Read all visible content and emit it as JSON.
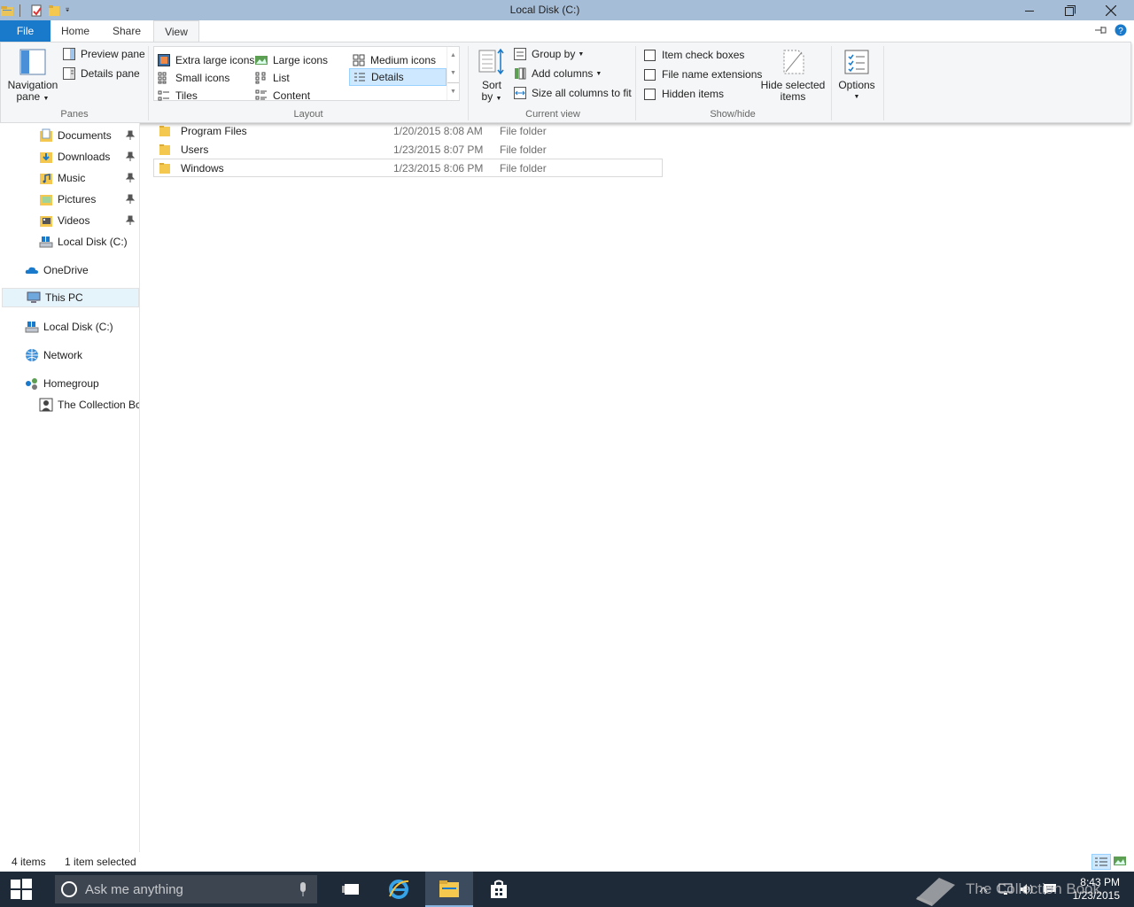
{
  "window": {
    "title": "Local Disk (C:)"
  },
  "ribbon": {
    "tabs": [
      {
        "label": "File"
      },
      {
        "label": "Home"
      },
      {
        "label": "Share"
      },
      {
        "label": "View"
      }
    ],
    "panes": {
      "navigation_pane_line1": "Navigation",
      "navigation_pane_line2": "pane",
      "preview_pane": "Preview pane",
      "details_pane": "Details pane",
      "group_label": "Panes"
    },
    "layout": {
      "items": [
        "Extra large icons",
        "Large icons",
        "Medium icons",
        "Small icons",
        "List",
        "Details",
        "Tiles",
        "Content"
      ],
      "selected": "Details",
      "group_label": "Layout"
    },
    "current_view": {
      "sort_line1": "Sort",
      "sort_line2": "by",
      "group_by": "Group by",
      "add_columns": "Add columns",
      "size_all_columns": "Size all columns to fit",
      "group_label": "Current view"
    },
    "show_hide": {
      "item_check_boxes": "Item check boxes",
      "file_name_extensions": "File name extensions",
      "hidden_items": "Hidden items",
      "hide_selected_line1": "Hide selected",
      "hide_selected_line2": "items",
      "group_label": "Show/hide"
    },
    "options": {
      "label": "Options"
    }
  },
  "navigation": {
    "items": [
      {
        "label": "Documents",
        "icon": "documents-icon",
        "pinned": true
      },
      {
        "label": "Downloads",
        "icon": "downloads-icon",
        "pinned": true
      },
      {
        "label": "Music",
        "icon": "music-icon",
        "pinned": true
      },
      {
        "label": "Pictures",
        "icon": "pictures-icon",
        "pinned": true
      },
      {
        "label": "Videos",
        "icon": "videos-icon",
        "pinned": true
      },
      {
        "label": "Local Disk (C:)",
        "icon": "drive-icon",
        "pinned": false
      },
      {
        "label": "OneDrive",
        "icon": "onedrive-icon"
      },
      {
        "label": "This PC",
        "icon": "pc-icon",
        "selected": true
      },
      {
        "label": "Local Disk (C:)",
        "icon": "drive-icon"
      },
      {
        "label": "Network",
        "icon": "network-icon"
      },
      {
        "label": "Homegroup",
        "icon": "homegroup-icon"
      },
      {
        "label": "The Collection Bc",
        "icon": "user-icon"
      }
    ]
  },
  "files": [
    {
      "name": "Program Files",
      "date": "1/20/2015 8:08 AM",
      "type": "File folder"
    },
    {
      "name": "Users",
      "date": "1/23/2015 8:07 PM",
      "type": "File folder"
    },
    {
      "name": "Windows",
      "date": "1/23/2015 8:06 PM",
      "type": "File folder",
      "selected": true
    }
  ],
  "status": {
    "count": "4 items",
    "selection": "1 item selected"
  },
  "taskbar": {
    "search_placeholder": "Ask me anything",
    "time": "8:43 PM",
    "date": "1/23/2015",
    "watermark": "The Collection Book"
  },
  "colors": {
    "titlebar": "#a6bdd8",
    "file_tab": "#1979ca",
    "taskbar": "#1f2a38",
    "selection": "#cde8ff"
  }
}
